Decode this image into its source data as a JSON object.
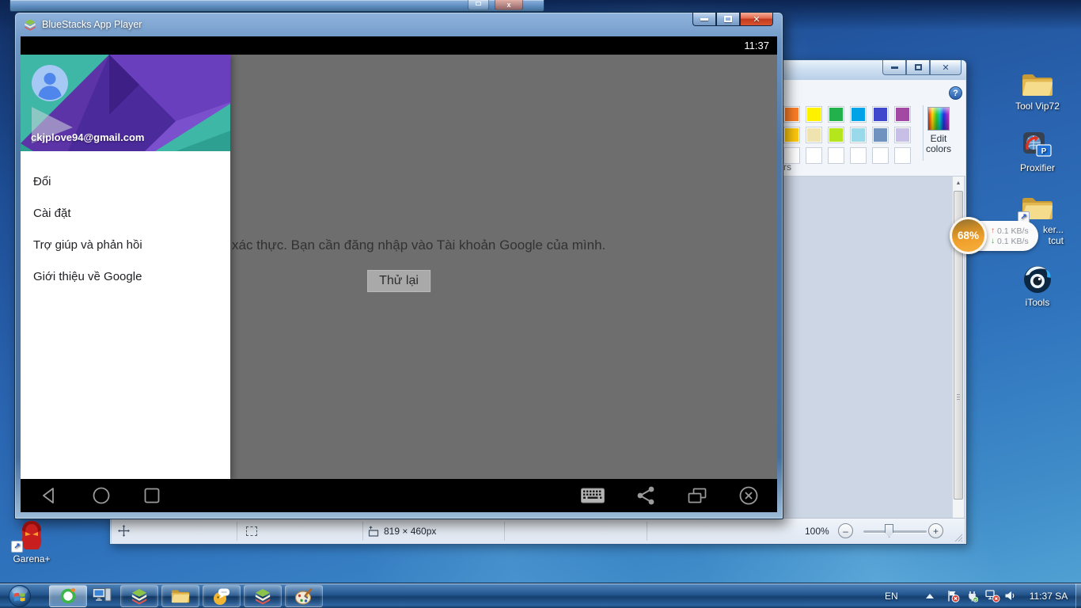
{
  "bluestacks": {
    "window_title": "BlueStacks App Player",
    "android_status_time": "11:37",
    "drawer": {
      "email": "ckjplove94@gmail.com",
      "items": [
        {
          "label": "Đổi"
        },
        {
          "label": "Cài đặt"
        },
        {
          "label": "Trợ giúp và phản hồi"
        },
        {
          "label": "Giới thiệu về Google"
        }
      ]
    },
    "content": {
      "message_visible": "xác thực. Bạn cần đăng nhập vào Tài khoản Google của mình.",
      "retry_label": "Thử lại"
    }
  },
  "paint": {
    "ribbon": {
      "edit_colors_label": "Edit colors",
      "colors_group_label_fragment": "rs",
      "palette_row1": [
        "#ff7f27",
        "#fff200",
        "#22b14c",
        "#00a2e8",
        "#3f48cc",
        "#a349a4"
      ],
      "palette_row2": [
        "#ffc90e",
        "#efe4b0",
        "#b5e61d",
        "#99d9ea",
        "#7092be",
        "#c8bfe7"
      ]
    },
    "status_bar": {
      "canvas_size": "819 × 460px",
      "zoom_level": "100%"
    }
  },
  "desktop_icons": {
    "tool_vip72": "Tool Vip72",
    "proxifier": "Proxifier",
    "hidden_shortcut_line1": "ker...",
    "hidden_shortcut_line2": "tcut",
    "itools": "iTools",
    "garena": "Garena+"
  },
  "network_badge": {
    "percent": "68%",
    "upload_speed": "0.1 KB/s",
    "download_speed": "0.1 KB/s"
  },
  "taskbar": {
    "language": "EN",
    "clock": "11:37 SA"
  }
}
